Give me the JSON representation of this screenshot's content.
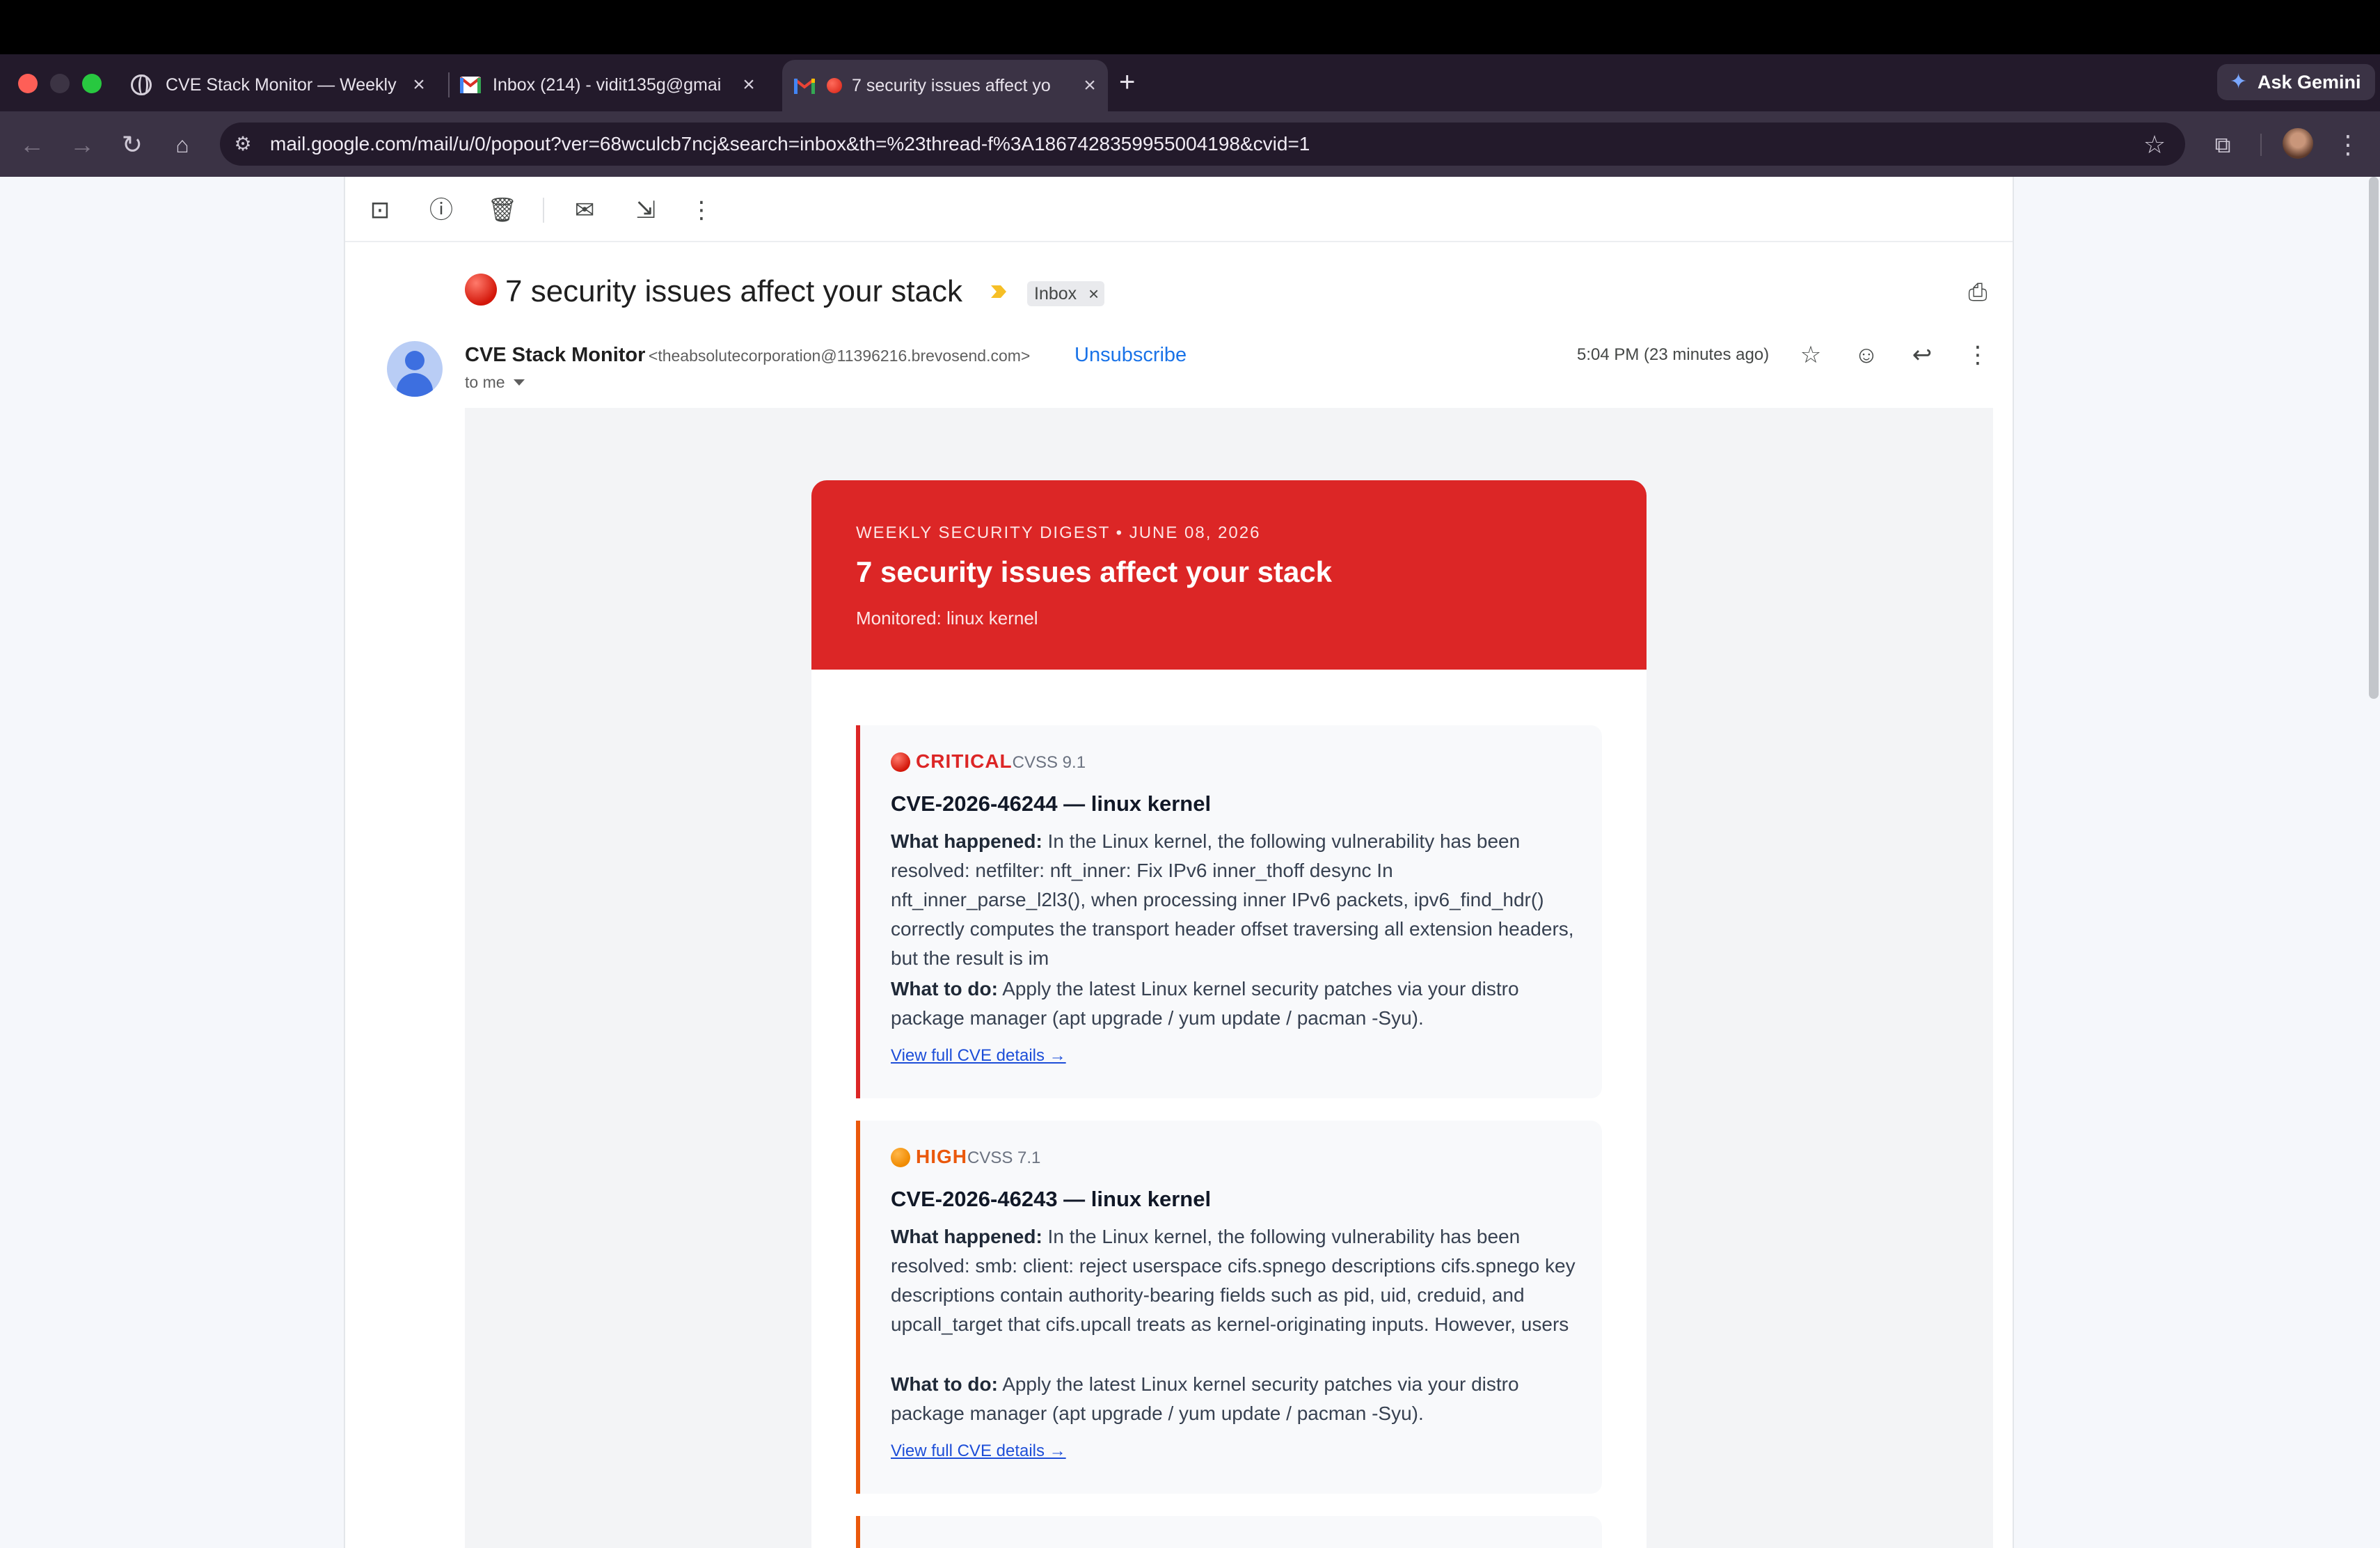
{
  "browser": {
    "tabs": [
      {
        "title": "CVE Stack Monitor — Weekly",
        "active": false
      },
      {
        "title": "Inbox (214) - vidit135g@gmai",
        "active": false
      },
      {
        "title": "7 security issues affect yo",
        "active": true
      }
    ],
    "tab_close_glyph": "×",
    "new_tab_glyph": "+",
    "ask_gemini_label": "Ask Gemini",
    "url": "mail.google.com/mail/u/0/popout?ver=68wculcb7ncj&search=inbox&th=%23thread-f%3A1867428359955004198&cvid=1"
  },
  "email": {
    "subject": "7 security issues affect your stack",
    "label_chip": "Inbox",
    "chip_remove_glyph": "×",
    "sender_name": "CVE Stack Monitor",
    "sender_email": "<theabsolutecorporation@11396216.brevosend.com>",
    "unsubscribe_label": "Unsubscribe",
    "recipient": "to me",
    "timestamp": "5:04 PM (23 minutes ago)"
  },
  "digest": {
    "kicker": "WEEKLY SECURITY DIGEST • JUNE 08, 2026",
    "title": "7 security issues affect your stack",
    "monitored": "Monitored: linux kernel",
    "what_happened_label": "What happened:",
    "what_to_do_label": "What to do:",
    "cves": [
      {
        "severity": "CRITICAL",
        "cvss": "CVSS 9.1",
        "color": "#dc2626",
        "title": "CVE-2026-46244 — linux kernel",
        "what_happened": "In the Linux kernel, the following vulnerability has been resolved: netfilter: nft_inner: Fix IPv6 inner_thoff desync In nft_inner_parse_l2l3(), when processing inner IPv6 packets, ipv6_find_hdr() correctly computes the transport header offset traversing all extension headers, but the result is im",
        "what_to_do": "Apply the latest Linux kernel security patches via your distro package manager (apt upgrade / yum update / pacman -Syu).",
        "link": "View full CVE details →"
      },
      {
        "severity": "HIGH",
        "cvss": "CVSS 7.1",
        "color": "#ea580c",
        "title": "CVE-2026-46243 — linux kernel",
        "what_happened": "In the Linux kernel, the following vulnerability has been resolved: smb: client: reject userspace cifs.spnego descriptions cifs.spnego key descriptions contain authority-bearing fields such as pid, uid, creduid, and upcall_target that cifs.upcall treats as kernel-originating inputs. However, users",
        "what_to_do": "Apply the latest Linux kernel security patches via your distro package manager (apt upgrade / yum update / pacman -Syu).",
        "link": "View full CVE details →"
      }
    ]
  },
  "colors": {
    "header_red": "#dc2626",
    "link_blue": "#1a73e8",
    "high_orange": "#ea580c"
  }
}
